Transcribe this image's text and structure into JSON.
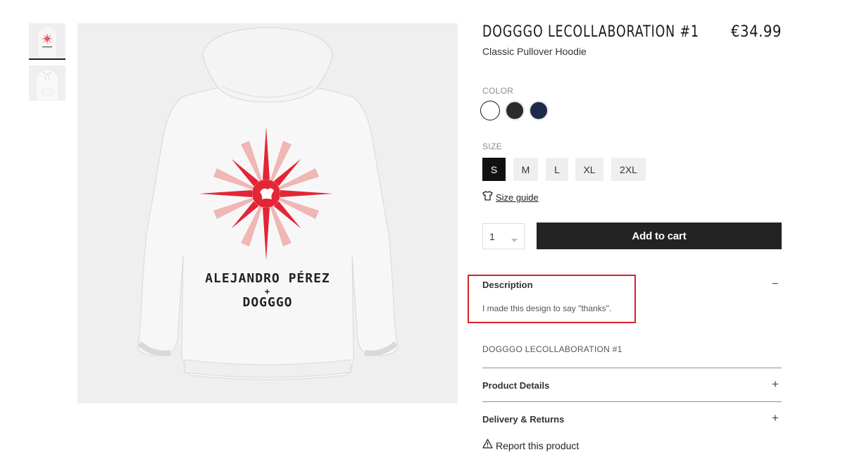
{
  "product": {
    "title": "DOGGGO LECOLLABORATION #1",
    "price": "€34.99",
    "subtitle": "Classic Pullover Hoodie"
  },
  "hoodie_print": {
    "line1": "ALEJANDRO PÉREZ",
    "plus": "+",
    "line2": "DOGGGO"
  },
  "color": {
    "label": "COLOR",
    "options": [
      "white",
      "black",
      "navy"
    ],
    "selected": "white",
    "swatches": {
      "white": "#ffffff",
      "black": "#2b2a29",
      "navy": "#1e2a4a"
    }
  },
  "size": {
    "label": "SIZE",
    "options": [
      "S",
      "M",
      "L",
      "XL",
      "2XL"
    ],
    "selected": "S",
    "guide_label": "Size guide"
  },
  "cart": {
    "quantity": "1",
    "add_label": "Add to cart"
  },
  "description": {
    "title": "Description",
    "toggle": "−",
    "text": "I made this design to say \"thanks\".",
    "repeat_title": "DOGGGO LECOLLABORATION #1"
  },
  "accordions": {
    "product_details": "Product Details",
    "delivery_returns": "Delivery & Returns",
    "expand": "+"
  },
  "report": {
    "label": "Report this product"
  },
  "colors": {
    "accent_dark": "#232323",
    "highlight_red": "#d9232e",
    "sun_red": "#e32636"
  }
}
